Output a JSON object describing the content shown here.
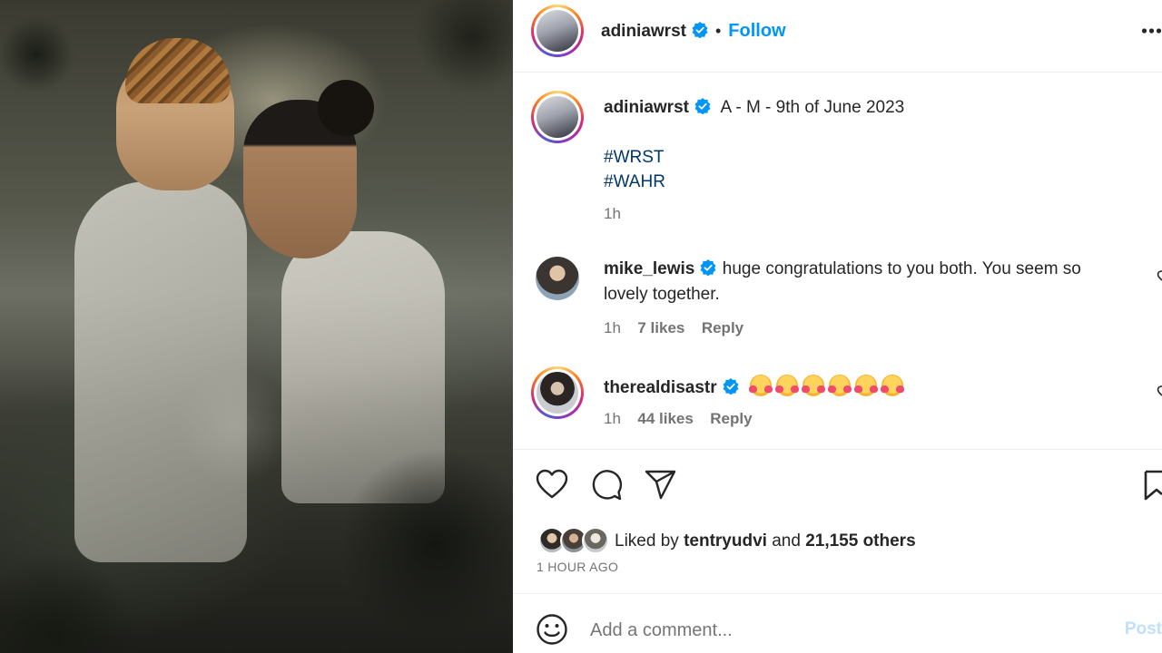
{
  "header": {
    "username": "adiniawrst",
    "separator": "•",
    "follow_label": "Follow"
  },
  "caption": {
    "username": "adiniawrst",
    "text": "A - M - 9th of June 2023",
    "hashtags": [
      "#WRST",
      "#WAHR"
    ],
    "time": "1h"
  },
  "comments": [
    {
      "username": "mike_lewis",
      "text_line1": "huge congratulations to you both. You seem so",
      "text_line2": "lovely together.",
      "time": "1h",
      "likes": "7 likes",
      "reply": "Reply"
    },
    {
      "username": "therealdisastr",
      "emoji_count": 6,
      "emoji_name": "smiling-face-with-hearts",
      "time": "1h",
      "likes": "44 likes",
      "reply": "Reply"
    }
  ],
  "likes": {
    "prefix": "Liked by",
    "user": "tentryudvi",
    "joiner": "and",
    "others": "21,155 others"
  },
  "post_time": "1 HOUR AGO",
  "comment_box": {
    "placeholder": "Add a comment...",
    "post_label": "Post"
  },
  "colors": {
    "accent": "#0095f6",
    "hashtag": "#00376b",
    "muted": "#737373",
    "text": "#262626"
  }
}
